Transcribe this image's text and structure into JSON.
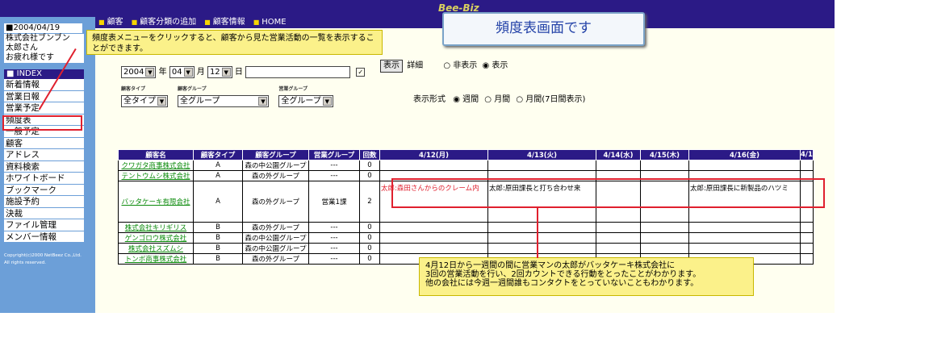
{
  "app": {
    "brand": "Bee-Biz"
  },
  "nav": {
    "items": [
      "顧客",
      "顧客分類の追加",
      "顧客情報",
      "HOME"
    ]
  },
  "sidebar": {
    "date": "■2004/04/19",
    "greeting": [
      "株式会社ブンブン",
      "太郎さん",
      "お疲れ様です"
    ],
    "index_header": "■ INDEX",
    "menu": [
      "新着情報",
      "営業日報",
      "営業予定",
      "頻度表",
      "一般予定",
      "顧客",
      "アドレス",
      "資料検索",
      "ホワイトボード",
      "ブックマーク",
      "施設予約",
      "決裁",
      "ファイル管理",
      "メンバー情報"
    ],
    "copyright": "Copyright(c)2000 NetBeez Co.,Ltd. All rights reserved."
  },
  "page_title": "頻度表画面です",
  "callout_top": "頻度表メニューをクリックすると、顧客から見た営業活動の一覧を表示することができます。",
  "callout_bottom": [
    "4月12日から一週間の間に営業マンの太郎がバッタケーキ株式会社に",
    "3回の営業活動を行い、2回カウントできる行動をとったことがわかります。",
    "他の会社には今週一週間誰もコンタクトをとっていないこともわかります。"
  ],
  "filters": {
    "year": "2004",
    "year_unit": "年",
    "month": "04",
    "month_unit": "月",
    "day": "12",
    "day_unit": "日",
    "display_button": "表示",
    "detail_label": "詳細",
    "detail_options": [
      "非表示",
      "表示"
    ],
    "detail_selected": "表示",
    "customer_type_label": "顧客タイプ",
    "customer_type_value": "全タイプ",
    "customer_group_label": "顧客グループ",
    "customer_group_value": "全グループ",
    "sales_group_label": "営業グループ",
    "sales_group_value": "全グループ",
    "format_label": "表示形式",
    "format_options": [
      "週間",
      "月間",
      "月間(7日間表示)"
    ],
    "format_selected": "週間"
  },
  "table": {
    "headers": [
      "顧客名",
      "顧客タイプ",
      "顧客グループ",
      "営業グループ",
      "回数",
      "4/12(月)",
      "4/13(火)",
      "4/14(水)",
      "4/15(木)",
      "4/16(金)",
      "4/1"
    ],
    "rows": [
      {
        "name": "クワガタ商事株式会社",
        "type": "A",
        "group": "森の中公園グループ",
        "sales": "---",
        "count": "0",
        "days": [
          "",
          "",
          "",
          "",
          "",
          ""
        ]
      },
      {
        "name": "テントウムシ株式会社",
        "type": "A",
        "group": "森の外グループ",
        "sales": "---",
        "count": "0",
        "days": [
          "",
          "",
          "",
          "",
          "",
          ""
        ]
      },
      {
        "name": "バッタケーキ有限会社",
        "type": "A",
        "group": "森の外グループ",
        "sales": "営業1課",
        "count": "2",
        "days": [
          "太郎:森田さんからのクレーム内",
          "太郎:原田課長と打ち合わせ来",
          "",
          "",
          "太郎:原田課長に新製品のハツミ",
          ""
        ]
      },
      {
        "name": "株式会社キリギリス",
        "type": "B",
        "group": "森の外グループ",
        "sales": "---",
        "count": "0",
        "days": [
          "",
          "",
          "",
          "",
          "",
          ""
        ]
      },
      {
        "name": "ゲンゴロウ株式会社",
        "type": "B",
        "group": "森の中公園グループ",
        "sales": "---",
        "count": "0",
        "days": [
          "",
          "",
          "",
          "",
          "",
          ""
        ]
      },
      {
        "name": "株式会社スズムシ",
        "type": "B",
        "group": "森の中公園グループ",
        "sales": "---",
        "count": "0",
        "days": [
          "",
          "",
          "",
          "",
          "",
          ""
        ]
      },
      {
        "name": "トンボ商事株式会社",
        "type": "B",
        "group": "森の外グループ",
        "sales": "---",
        "count": "0",
        "days": [
          "",
          "",
          "",
          "",
          "",
          ""
        ]
      }
    ]
  }
}
